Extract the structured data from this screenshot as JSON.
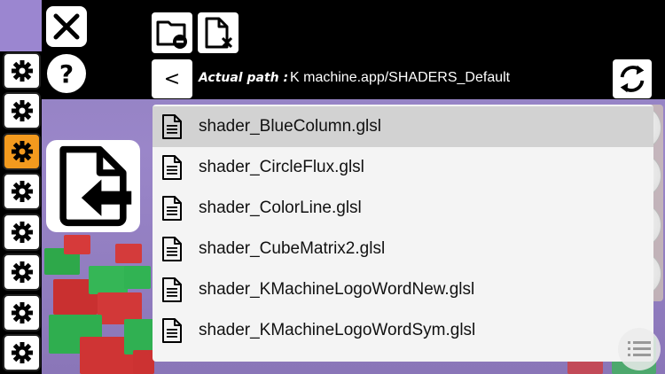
{
  "window": {
    "close_icon": "close-icon",
    "help_icon": "help-icon"
  },
  "toolbar": {
    "folder_minus_icon": "folder-remove-icon",
    "file_x_icon": "file-delete-icon",
    "back_label": "<",
    "refresh_icon": "refresh-icon"
  },
  "path": {
    "label": "Actual path :",
    "value": "K machine.app/SHADERS_Default"
  },
  "gear_buttons": [
    {
      "active": false
    },
    {
      "active": false
    },
    {
      "active": true
    },
    {
      "active": false
    },
    {
      "active": false
    },
    {
      "active": false
    },
    {
      "active": false
    },
    {
      "active": false
    }
  ],
  "import_icon": "file-import-icon",
  "files": [
    {
      "name": "shader_BlueColumn.glsl",
      "selected": true
    },
    {
      "name": "shader_CircleFlux.glsl",
      "selected": false
    },
    {
      "name": "shader_ColorLine.glsl",
      "selected": false
    },
    {
      "name": "shader_CubeMatrix2.glsl",
      "selected": false
    },
    {
      "name": "shader_KMachineLogoWordNew.glsl",
      "selected": false
    },
    {
      "name": "shader_KMachineLogoWordSym.glsl",
      "selected": false
    }
  ],
  "colors": {
    "active_gear": "#f39a1e",
    "selected_row": "#d2d2d2",
    "panel_bg": "#f4f4f4",
    "background_purple": "#9a86c9"
  },
  "menu_icon": "list-menu-icon"
}
